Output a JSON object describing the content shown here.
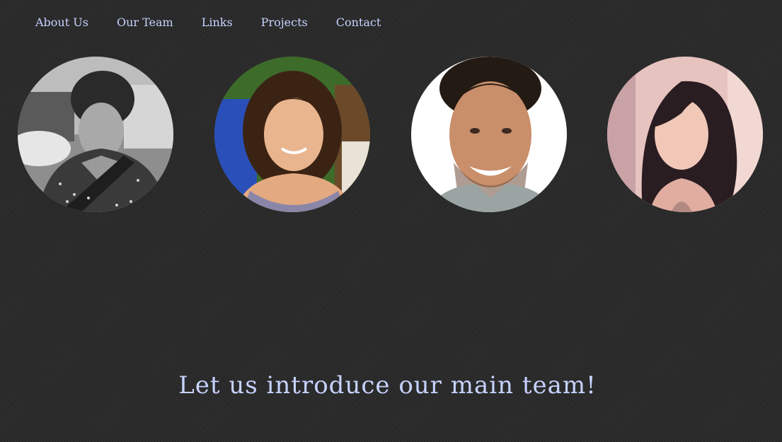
{
  "nav": {
    "items": [
      {
        "label": "About Us"
      },
      {
        "label": "Our Team"
      },
      {
        "label": "Links"
      },
      {
        "label": "Projects"
      },
      {
        "label": "Contact"
      }
    ]
  },
  "team": {
    "members": [
      {
        "photo": "grayscale-portrait-woman-curly-hair"
      },
      {
        "photo": "color-portrait-woman-dark-bob-hair"
      },
      {
        "photo": "color-portrait-man-smiling"
      },
      {
        "photo": "color-portrait-woman-long-dark-hair"
      }
    ]
  },
  "headline": "Let us introduce our main team!",
  "colors": {
    "background": "#2b2b2b",
    "accent_text": "#c7d3ff"
  }
}
